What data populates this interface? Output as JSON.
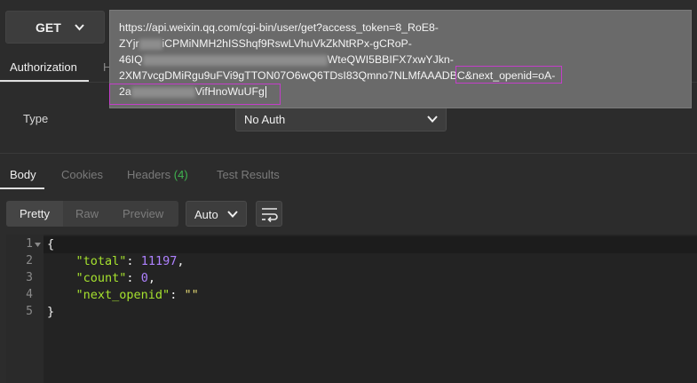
{
  "request": {
    "method": "GET",
    "url_lines": [
      {
        "text": "https://api.weixin.qq.com/cgi-bin/user/get?access_token=8_RoE8-",
        "blur": null
      },
      {
        "text_before": "ZYjr",
        "blur_w": 26,
        "text_after": "iCPMiNMH2hISShqf9RswLVhuVkZkNtRPx-gCRoP-"
      },
      {
        "text_before": "46IQ",
        "blur_w": 208,
        "text_after": "WteQWI5BBIFX7xwYJkn-"
      },
      {
        "text_before": "2XM7vcgDMiRgu9uFVi9gTTON07O6wQ6TDsI83Qmno7NLMfAAADBC",
        "blur_w": 0,
        "text_after": "&next_openid=oA-"
      },
      {
        "text_before": "2a",
        "blur_w": 72,
        "text_after": "VifHnoWuUFg"
      }
    ]
  },
  "request_tabs": {
    "authorization": "Authorization",
    "other": "H"
  },
  "auth": {
    "type_label": "Type",
    "selected": "No Auth"
  },
  "response_tabs": {
    "body": "Body",
    "cookies": "Cookies",
    "headers": "Headers",
    "headers_count": "(4)",
    "test_results": "Test Results"
  },
  "view": {
    "pretty": "Pretty",
    "raw": "Raw",
    "preview": "Preview",
    "format": "Auto"
  },
  "response_body": {
    "line_numbers": [
      "1",
      "2",
      "3",
      "4",
      "5"
    ],
    "open_brace": "{",
    "close_brace": "}",
    "total_key": "\"total\"",
    "total_val": "11197",
    "count_key": "\"count\"",
    "count_val": "0",
    "next_key": "\"next_openid\"",
    "next_val": "\"\""
  },
  "colors": {
    "highlight_box": "#c33ec9",
    "headers_badge": "#3fb34f"
  }
}
